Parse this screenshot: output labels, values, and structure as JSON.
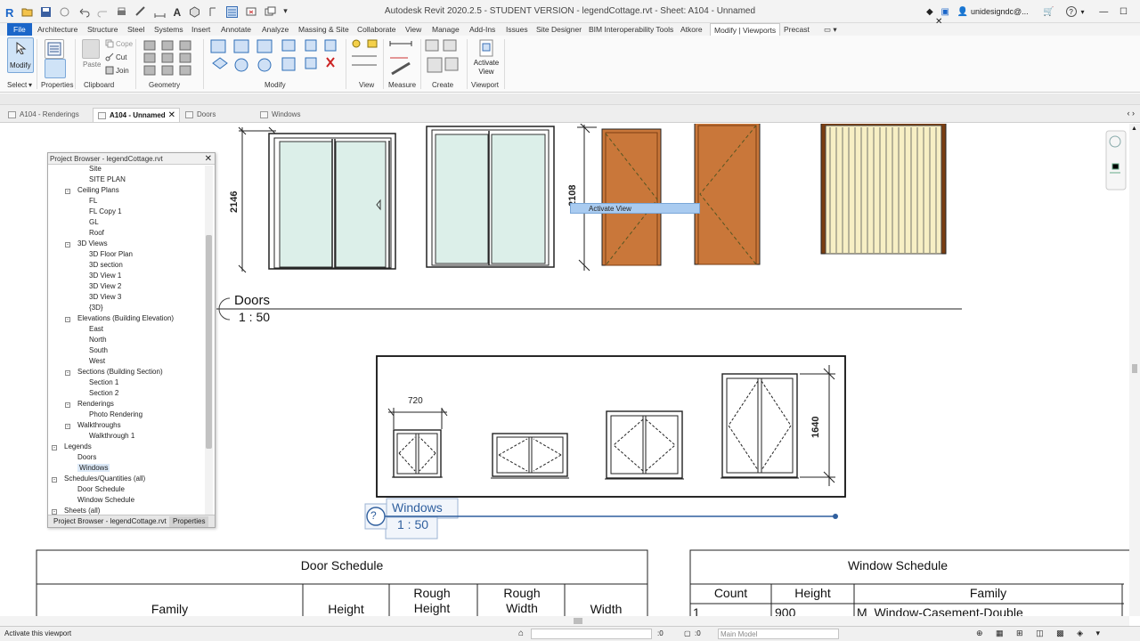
{
  "app": {
    "title": "Autodesk Revit 2020.2.5 - STUDENT VERSION - legendCottage.rvt - Sheet: A104 - Unnamed",
    "logo": "R",
    "user": "unidesigndc@...",
    "help": "?"
  },
  "ribbon": {
    "tabs": [
      "File",
      "Architecture",
      "Structure",
      "Steel",
      "Systems",
      "Insert",
      "Annotate",
      "Analyze",
      "Massing & Site",
      "Collaborate",
      "View",
      "Manage",
      "Add-Ins",
      "Issues",
      "Site Designer",
      "BIM Interoperability Tools",
      "Atkore",
      "Modify | Viewports",
      "Precast"
    ],
    "active_tab": "Modify | Viewports",
    "modify_label": "Modify",
    "paste_label": "Paste",
    "cope_label": "Cope",
    "cut_label": "Cut",
    "join_label": "Join",
    "activate_view_label": "Activate View",
    "groups": [
      "Select",
      "Properties",
      "Clipboard",
      "Geometry",
      "Modify",
      "View",
      "Measure",
      "Create",
      "Viewport"
    ]
  },
  "doc_tabs": [
    {
      "label": "A104 - Renderings",
      "active": false
    },
    {
      "label": "A104 - Unnamed",
      "active": true
    },
    {
      "label": "Doors",
      "active": false
    },
    {
      "label": "Windows",
      "active": false
    }
  ],
  "project_browser": {
    "title": "Project Browser - legendCottage.rvt",
    "items": [
      {
        "label": "Site",
        "level": 2
      },
      {
        "label": "SITE PLAN",
        "level": 2
      },
      {
        "label": "Ceiling Plans",
        "level": 1,
        "toggle": "-"
      },
      {
        "label": "FL",
        "level": 2
      },
      {
        "label": "FL Copy 1",
        "level": 2
      },
      {
        "label": "GL",
        "level": 2
      },
      {
        "label": "Roof",
        "level": 2
      },
      {
        "label": "3D Views",
        "level": 1,
        "toggle": "-"
      },
      {
        "label": "3D Floor Plan",
        "level": 2
      },
      {
        "label": "3D section",
        "level": 2
      },
      {
        "label": "3D View 1",
        "level": 2
      },
      {
        "label": "3D View 2",
        "level": 2
      },
      {
        "label": "3D View 3",
        "level": 2
      },
      {
        "label": "{3D}",
        "level": 2
      },
      {
        "label": "Elevations (Building Elevation)",
        "level": 1,
        "toggle": "-"
      },
      {
        "label": "East",
        "level": 2
      },
      {
        "label": "North",
        "level": 2
      },
      {
        "label": "South",
        "level": 2
      },
      {
        "label": "West",
        "level": 2
      },
      {
        "label": "Sections (Building Section)",
        "level": 1,
        "toggle": "-"
      },
      {
        "label": "Section 1",
        "level": 2
      },
      {
        "label": "Section 2",
        "level": 2
      },
      {
        "label": "Renderings",
        "level": 1,
        "toggle": "-"
      },
      {
        "label": "Photo Rendering",
        "level": 2
      },
      {
        "label": "Walkthroughs",
        "level": 1,
        "toggle": "-"
      },
      {
        "label": "Walkthrough 1",
        "level": 2
      },
      {
        "label": "Legends",
        "level": 0,
        "toggle": "-"
      },
      {
        "label": "Doors",
        "level": 1
      },
      {
        "label": "Windows",
        "level": 1,
        "selected": true
      },
      {
        "label": "Schedules/Quantities (all)",
        "level": 0,
        "toggle": "-"
      },
      {
        "label": "Door Schedule",
        "level": 1
      },
      {
        "label": "Window Schedule",
        "level": 1
      },
      {
        "label": "Sheets (all)",
        "level": 0,
        "toggle": "-"
      }
    ],
    "footer_tabs": [
      "Project Browser - legendCottage.rvt",
      "Properties"
    ]
  },
  "sheet": {
    "doors_view": {
      "title": "Doors",
      "scale": "1 : 50",
      "dim_height": "2146",
      "dim_door": "2108"
    },
    "windows_view": {
      "title": "Windows",
      "scale": "1 : 50",
      "dim_width": "720",
      "dim_height": "1640"
    },
    "tooltip": "Activate View",
    "question": "?"
  },
  "door_schedule": {
    "title": "Door Schedule",
    "columns": [
      "Family",
      "Height",
      "Rough Height",
      "Rough Width",
      "Width"
    ]
  },
  "window_schedule": {
    "title": "Window Schedule",
    "columns": [
      "Count",
      "Height",
      "Family"
    ],
    "rows": [
      [
        "1",
        "900",
        "M_Window-Casement-Double"
      ]
    ]
  },
  "status": {
    "text": "Activate this viewport",
    "zero1": ":0",
    "zero2": ":0",
    "model": "Main Model"
  },
  "colors": {
    "file_tab": "#1b66c9",
    "door_wood": "#c9773a",
    "glass": "#dcefe9",
    "curtain": "#f7efc4",
    "select_blue": "#2f5f9e"
  }
}
